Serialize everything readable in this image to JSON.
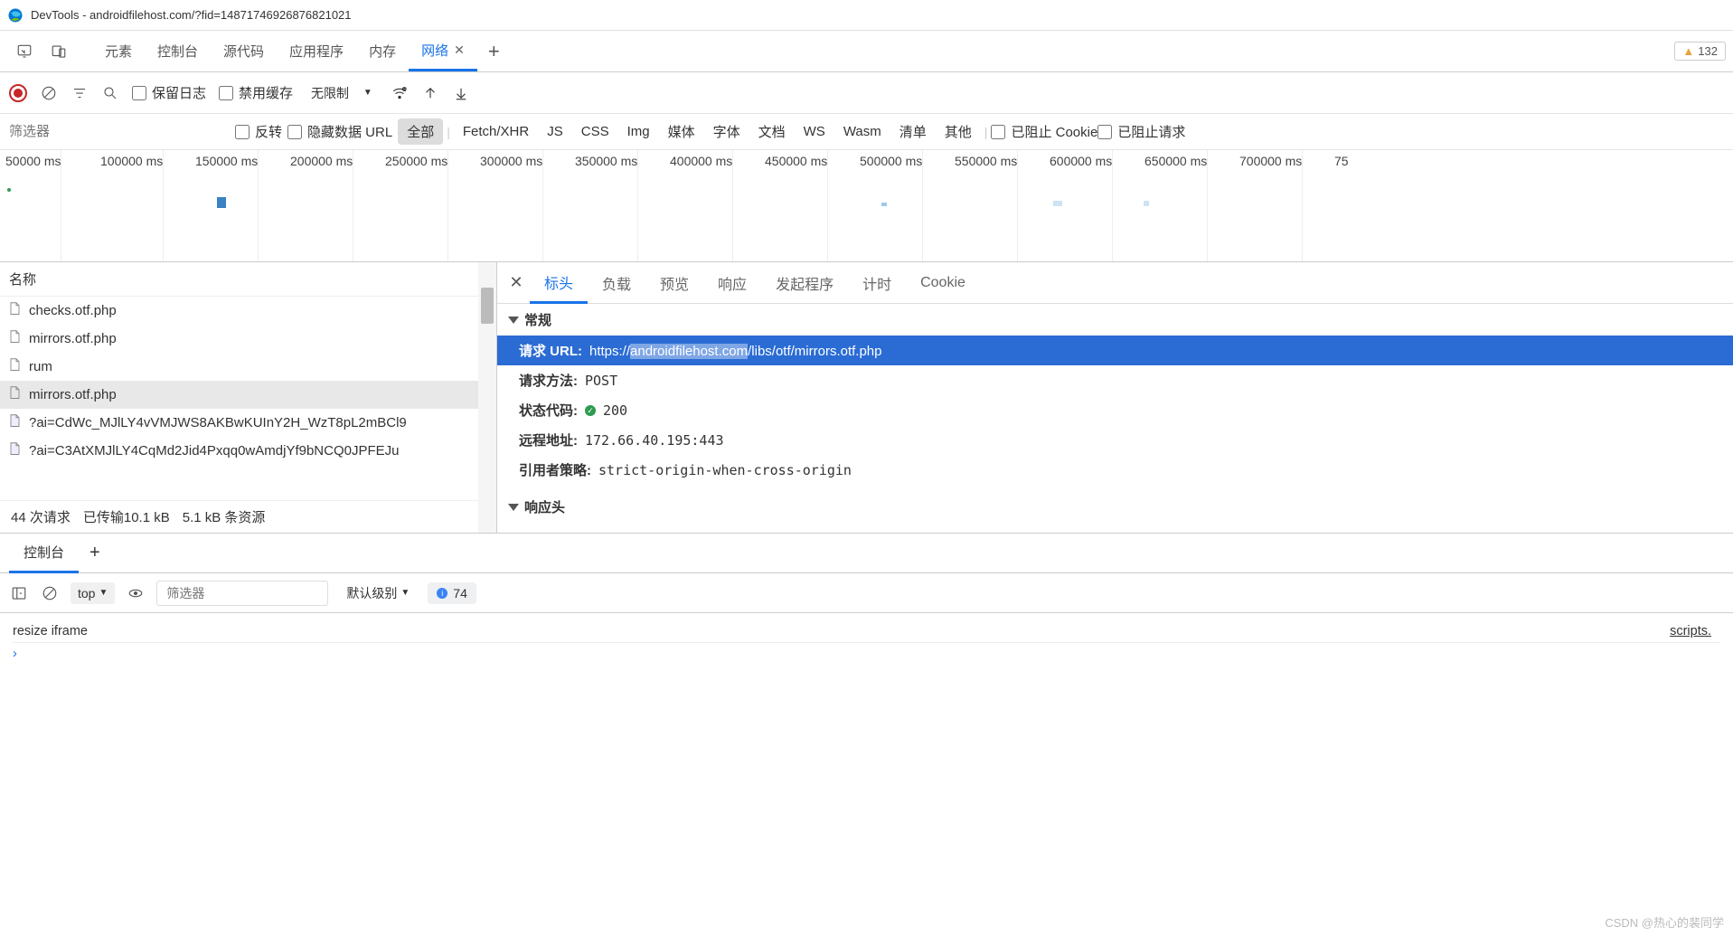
{
  "titlebar": {
    "title": "DevTools - androidfilehost.com/?fid=14871746926876821021"
  },
  "main_tabs": {
    "items": [
      "元素",
      "控制台",
      "源代码",
      "应用程序",
      "内存",
      "网络"
    ],
    "active_index": 5,
    "closeable_index": 5,
    "warning_count": "132"
  },
  "toolbar": {
    "preserve_log": "保留日志",
    "disable_cache": "禁用缓存",
    "throttle": "无限制"
  },
  "filter": {
    "placeholder": "筛选器",
    "invert": "反转",
    "hide_data": "隐藏数据 URL",
    "types": [
      "全部",
      "Fetch/XHR",
      "JS",
      "CSS",
      "Img",
      "媒体",
      "字体",
      "文档",
      "WS",
      "Wasm",
      "清单",
      "其他"
    ],
    "active_type_index": 0,
    "blocked_cookies": "已阻止 Cookie",
    "blocked_requests": "已阻止请求"
  },
  "timeline": {
    "ticks": [
      "50000 ms",
      "100000 ms",
      "150000 ms",
      "200000 ms",
      "250000 ms",
      "300000 ms",
      "350000 ms",
      "400000 ms",
      "450000 ms",
      "500000 ms",
      "550000 ms",
      "600000 ms",
      "650000 ms",
      "700000 ms",
      "75"
    ]
  },
  "requests": {
    "header": "名称",
    "items": [
      "checks.otf.php",
      "mirrors.otf.php",
      "rum",
      "mirrors.otf.php",
      "?ai=CdWc_MJlLY4vVMJWS8AKBwKUInY2H_WzT8pL2mBCl9",
      "?ai=C3AtXMJlLY4CqMd2Jid4Pxqq0wAmdjYf9bNCQ0JPFEJu"
    ],
    "selected_index": 3,
    "footer": {
      "requests": "44 次请求",
      "transferred": "已传输10.1 kB",
      "resources": "5.1 kB 条资源"
    }
  },
  "detail": {
    "tabs": [
      "标头",
      "负载",
      "预览",
      "响应",
      "发起程序",
      "计时",
      "Cookie"
    ],
    "active_index": 0,
    "section_general": "常规",
    "url_label": "请求 URL:",
    "url_pre": "https://",
    "url_mid": "androidfilehost.com",
    "url_post": "/libs/otf/mirrors.otf.php",
    "method_label": "请求方法:",
    "method_value": "POST",
    "status_label": "状态代码:",
    "status_value": "200",
    "remote_label": "远程地址:",
    "remote_value": "172.66.40.195:443",
    "referrer_label": "引用者策略:",
    "referrer_value": "strict-origin-when-cross-origin",
    "section_response": "响应头"
  },
  "drawer": {
    "tabs": [
      "控制台"
    ],
    "active_index": 0
  },
  "console": {
    "context": "top",
    "placeholder": "筛选器",
    "level": "默认级别",
    "issue_count": "74",
    "message": "resize iframe",
    "source": "scripts.",
    "prompt": "›"
  },
  "watermark": "CSDN @热心的裴同学"
}
